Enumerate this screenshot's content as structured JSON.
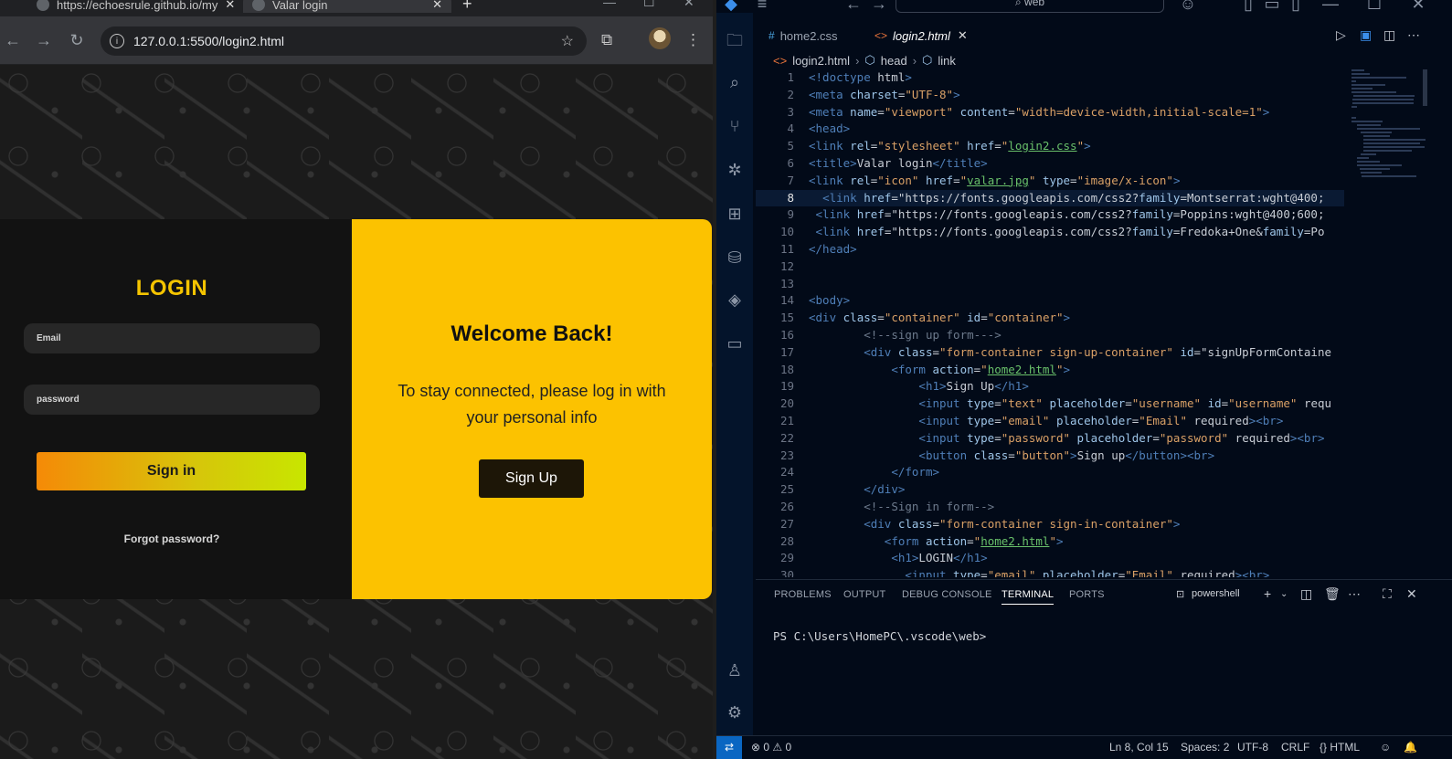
{
  "browser": {
    "tabs": [
      {
        "label": "https://echoesrule.github.io/my",
        "active": false
      },
      {
        "label": "Valar login",
        "active": true
      }
    ],
    "url": "127.0.0.1:5500/login2.html"
  },
  "page": {
    "login_title": "LOGIN",
    "email_placeholder": "Email",
    "password_placeholder": "password",
    "signin_label": "Sign in",
    "forgot_label": "Forgot password?",
    "welcome_title": "Welcome Back!",
    "welcome_text": "To stay connected, please log in with your personal info",
    "signup_label": "Sign Up",
    "colors": {
      "accent": "#fcc200",
      "dark": "#121212",
      "gradient_start": "#f58a07",
      "gradient_end": "#c8e600"
    }
  },
  "vscode": {
    "search": "web",
    "tabs": [
      {
        "label": "home2.css",
        "glyph": "#",
        "active": false
      },
      {
        "label": "login2.html",
        "glyph": "<>",
        "active": true
      }
    ],
    "breadcrumb": [
      "login2.html",
      "head",
      "link"
    ],
    "current_line": 8,
    "code_lines": [
      "<!doctype html>",
      "<meta charset=\"UTF-8\">",
      "<meta name=\"viewport\" content=\"width=device-width,initial-scale=1\">",
      "<head>",
      "<link rel=\"stylesheet\" href=\"login2.css\">",
      "<title>Valar login</title>",
      "<link rel=\"icon\" href=\"valar.jpg\" type=\"image/x-icon\">",
      "  <link href=\"https://fonts.googleapis.com/css2?family=Montserrat:wght@400;",
      " <link href=\"https://fonts.googleapis.com/css2?family=Poppins:wght@400;600;",
      " <link href=\"https://fonts.googleapis.com/css2?family=Fredoka+One&family=Po",
      "</head>",
      "",
      "",
      "<body>",
      "<div class=\"container\" id=\"container\">",
      "        <!--sign up form--->",
      "        <div class=\"form-container sign-up-container\" id=\"signUpFormContaine",
      "            <form action=\"home2.html\">",
      "                <h1>Sign Up</h1>",
      "                <input type=\"text\" placeholder=\"username\" id=\"username\" requ",
      "                <input type=\"email\" placeholder=\"Email\" required><br>",
      "                <input type=\"password\" placeholder=\"password\" required><br>",
      "                <button class=\"button\">Sign up</button><br>",
      "            </form>",
      "        </div>",
      "        <!--Sign in form-->",
      "        <div class=\"form-container sign-in-container\">",
      "           <form action=\"home2.html\">",
      "            <h1>LOGIN</h1>",
      "              <input type=\"email\" placeholder=\"Email\" required><br>"
    ],
    "panel_tabs": [
      "PROBLEMS",
      "OUTPUT",
      "DEBUG CONSOLE",
      "TERMINAL",
      "PORTS"
    ],
    "active_panel": "TERMINAL",
    "terminal_name": "powershell",
    "prompt": "PS C:\\Users\\HomePC\\.vscode\\web>",
    "status": {
      "problems": "⊗ 0 ⚠ 0",
      "position": "Ln 8, Col 15",
      "spaces": "Spaces: 2",
      "encoding": "UTF-8",
      "eol": "CRLF",
      "language": "{} HTML"
    }
  }
}
